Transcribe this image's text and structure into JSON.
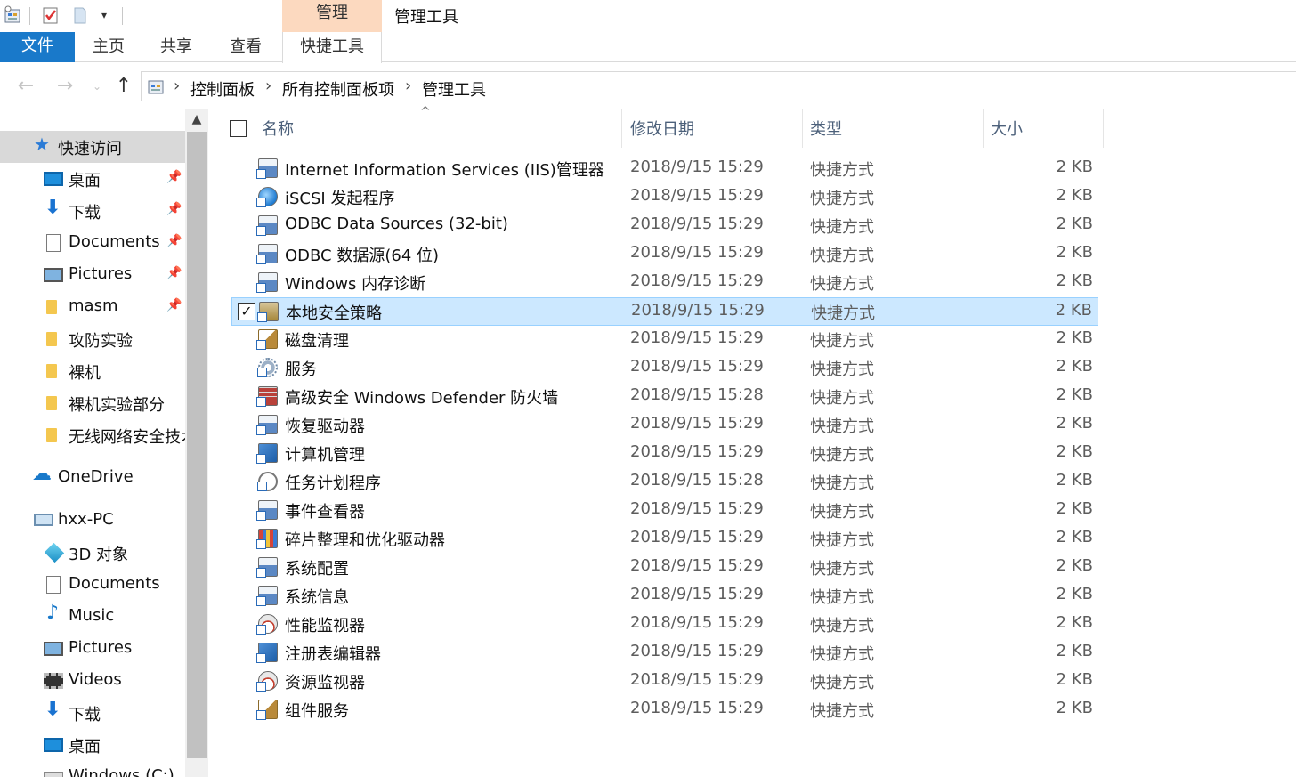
{
  "window": {
    "title": "管理工具",
    "contextual_tab_group": "管理"
  },
  "ribbon": {
    "tabs": [
      {
        "label": "文件",
        "active": true
      },
      {
        "label": "主页"
      },
      {
        "label": "共享"
      },
      {
        "label": "查看"
      },
      {
        "label": "快捷工具"
      }
    ]
  },
  "address": {
    "breadcrumbs": [
      "控制面板",
      "所有控制面板项",
      "管理工具"
    ],
    "back_icon": "arrow-left-icon",
    "forward_icon": "arrow-right-icon",
    "recent_icon": "chevron-down-icon",
    "up_icon": "arrow-up-icon"
  },
  "nav": {
    "quick_access": "快速访问",
    "pinned": [
      {
        "label": "桌面",
        "icon": "desktop-icon",
        "pinned": true
      },
      {
        "label": "下载",
        "icon": "download-icon",
        "pinned": true
      },
      {
        "label": "Documents",
        "icon": "documents-icon",
        "pinned": true
      },
      {
        "label": "Pictures",
        "icon": "pictures-icon",
        "pinned": true
      },
      {
        "label": "masm",
        "icon": "folder-icon",
        "pinned": true
      },
      {
        "label": "攻防实验",
        "icon": "folder-icon"
      },
      {
        "label": "裸机",
        "icon": "folder-icon"
      },
      {
        "label": "裸机实验部分",
        "icon": "folder-icon"
      },
      {
        "label": "无线网络安全技术",
        "icon": "folder-icon"
      }
    ],
    "onedrive": "OneDrive",
    "pc": "hxx-PC",
    "pc_items": [
      {
        "label": "3D 对象",
        "icon": "3d-objects-icon"
      },
      {
        "label": "Documents",
        "icon": "documents-icon"
      },
      {
        "label": "Music",
        "icon": "music-icon"
      },
      {
        "label": "Pictures",
        "icon": "pictures-icon"
      },
      {
        "label": "Videos",
        "icon": "videos-icon"
      },
      {
        "label": "下载",
        "icon": "download-icon"
      },
      {
        "label": "桌面",
        "icon": "desktop-icon"
      },
      {
        "label": "Windows (C:)",
        "icon": "drive-icon"
      }
    ]
  },
  "columns": {
    "name": "名称",
    "date": "修改日期",
    "type": "类型",
    "size": "大小"
  },
  "files": [
    {
      "name": "Internet Information Services (IIS)管理器",
      "date": "2018/9/15 15:29",
      "type": "快捷方式",
      "size": "2 KB",
      "icon": "iis-icon"
    },
    {
      "name": "iSCSI 发起程序",
      "date": "2018/9/15 15:29",
      "type": "快捷方式",
      "size": "2 KB",
      "icon": "iscsi-globe-icon"
    },
    {
      "name": "ODBC Data Sources (32-bit)",
      "date": "2018/9/15 15:29",
      "type": "快捷方式",
      "size": "2 KB",
      "icon": "odbc-icon"
    },
    {
      "name": "ODBC 数据源(64 位)",
      "date": "2018/9/15 15:29",
      "type": "快捷方式",
      "size": "2 KB",
      "icon": "odbc-icon"
    },
    {
      "name": "Windows 内存诊断",
      "date": "2018/9/15 15:29",
      "type": "快捷方式",
      "size": "2 KB",
      "icon": "memory-diagnostic-icon"
    },
    {
      "name": "本地安全策略",
      "date": "2018/9/15 15:29",
      "type": "快捷方式",
      "size": "2 KB",
      "icon": "security-policy-icon",
      "selected": true
    },
    {
      "name": "磁盘清理",
      "date": "2018/9/15 15:29",
      "type": "快捷方式",
      "size": "2 KB",
      "icon": "disk-cleanup-icon"
    },
    {
      "name": "服务",
      "date": "2018/9/15 15:29",
      "type": "快捷方式",
      "size": "2 KB",
      "icon": "services-gear-icon"
    },
    {
      "name": "高级安全 Windows Defender 防火墙",
      "date": "2018/9/15 15:28",
      "type": "快捷方式",
      "size": "2 KB",
      "icon": "firewall-icon"
    },
    {
      "name": "恢复驱动器",
      "date": "2018/9/15 15:29",
      "type": "快捷方式",
      "size": "2 KB",
      "icon": "recovery-drive-icon"
    },
    {
      "name": "计算机管理",
      "date": "2018/9/15 15:29",
      "type": "快捷方式",
      "size": "2 KB",
      "icon": "computer-management-icon"
    },
    {
      "name": "任务计划程序",
      "date": "2018/9/15 15:28",
      "type": "快捷方式",
      "size": "2 KB",
      "icon": "task-scheduler-clock-icon"
    },
    {
      "name": "事件查看器",
      "date": "2018/9/15 15:29",
      "type": "快捷方式",
      "size": "2 KB",
      "icon": "event-viewer-icon"
    },
    {
      "name": "碎片整理和优化驱动器",
      "date": "2018/9/15 15:29",
      "type": "快捷方式",
      "size": "2 KB",
      "icon": "defrag-icon"
    },
    {
      "name": "系统配置",
      "date": "2018/9/15 15:29",
      "type": "快捷方式",
      "size": "2 KB",
      "icon": "system-config-icon"
    },
    {
      "name": "系统信息",
      "date": "2018/9/15 15:29",
      "type": "快捷方式",
      "size": "2 KB",
      "icon": "system-info-icon"
    },
    {
      "name": "性能监视器",
      "date": "2018/9/15 15:29",
      "type": "快捷方式",
      "size": "2 KB",
      "icon": "performance-gauge-icon"
    },
    {
      "name": "注册表编辑器",
      "date": "2018/9/15 15:29",
      "type": "快捷方式",
      "size": "2 KB",
      "icon": "registry-editor-icon"
    },
    {
      "name": "资源监视器",
      "date": "2018/9/15 15:29",
      "type": "快捷方式",
      "size": "2 KB",
      "icon": "resource-gauge-icon"
    },
    {
      "name": "组件服务",
      "date": "2018/9/15 15:29",
      "type": "快捷方式",
      "size": "2 KB",
      "icon": "component-services-icon"
    }
  ],
  "colors": {
    "file_tab": "#1979ca",
    "manage_tab": "#fcd9bf",
    "selection_bg": "#cce8ff",
    "selection_border": "#99d1ff",
    "nav_selected": "#d9d9d9"
  }
}
